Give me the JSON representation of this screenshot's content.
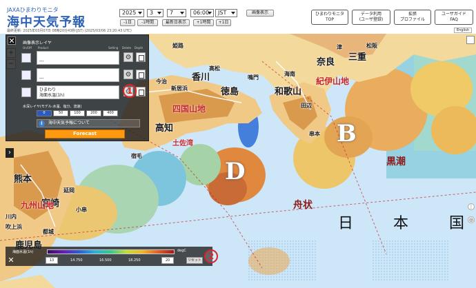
{
  "header": {
    "brand_small": "JAXAひまわりモニタ",
    "brand_big": "海中天気予報",
    "updated": "最終更新: 2025年03月07日 08時20分43秒(JST) (2025/03/06 23:20:43 UTC)",
    "year": "2025",
    "month": "3",
    "day": "7",
    "time": "06:00",
    "timezone": "JST",
    "image_display": "画像表示",
    "step_buttons": [
      "-1日",
      "-1時間",
      "最新日表示",
      "+1時間",
      "+1日"
    ],
    "nav": [
      {
        "line1": "ひまわりモニタ",
        "line2": "TOP"
      },
      {
        "line1": "データ利用",
        "line2": "(ユーザ登録)"
      },
      {
        "line1": "拡張",
        "line2": "プロファイル"
      },
      {
        "line1": "ユーザガイド",
        "line2": "FAQ"
      }
    ],
    "language": "English"
  },
  "layer_panel": {
    "title": "画像表示レイヤ",
    "col_onoff": "On/Off",
    "col_product": "Product",
    "col_setting": "Setting",
    "col_delete": "Delete",
    "col_depth": "Depth",
    "layers": [
      {
        "line1": "",
        "line2": "---"
      },
      {
        "line1": "",
        "line2": "---"
      },
      {
        "line1": "ひまわり",
        "line2": "海面水温(1h)"
      }
    ],
    "depth_title": "水深レイヤ(モデル:水温、塩分、流速)",
    "depths": [
      "0",
      "50",
      "100",
      "200",
      "400"
    ],
    "depth_active": "0",
    "info": "海中天気予報について",
    "forecast": "Forecast"
  },
  "zoom": {
    "in": "+",
    "out": "−"
  },
  "map": {
    "prefectures": [
      "香川",
      "徳島",
      "和歌山",
      "奈良",
      "三重",
      "高知",
      "熊本",
      "宮崎",
      "鹿児島"
    ],
    "cities": [
      "今治",
      "新居浜",
      "高松",
      "鳴門",
      "海南",
      "田辺",
      "松阪",
      "津",
      "宿毛",
      "延岡",
      "都城",
      "川内",
      "吹上浜",
      "小串",
      "姫路",
      "串本"
    ],
    "regions_red": [
      "四国山地",
      "紀伊山地",
      "九州山地",
      "土佐湾"
    ],
    "seas": [
      "黒潮",
      "舟状"
    ],
    "letters": [
      "B",
      "D"
    ],
    "country": [
      "日",
      "本",
      "国"
    ],
    "circle_1": "1",
    "circle_2": "2"
  },
  "colorbar": {
    "label": "海面水温(1h)",
    "unit": "degC",
    "min": "13",
    "ticks": [
      "14.750",
      "16.500",
      "18.250"
    ],
    "max": "20",
    "reset": "リセット"
  }
}
